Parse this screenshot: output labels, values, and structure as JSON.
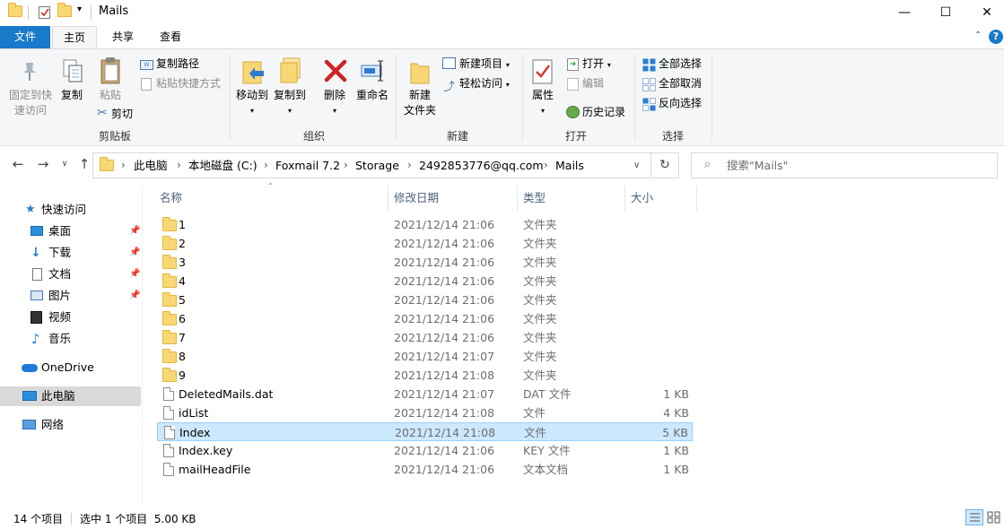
{
  "window": {
    "title": "Mails",
    "minimize": "—",
    "maximize": "☐",
    "close": "✕"
  },
  "ribbon_tabs": {
    "file": "文件",
    "home": "主页",
    "share": "共享",
    "view": "查看"
  },
  "ribbon": {
    "clipboard": {
      "pin_quick_access": "固定到快速访问",
      "pin_line1": "固定到快",
      "pin_line2": "速访问",
      "copy": "复制",
      "paste": "粘贴",
      "copy_path": "复制路径",
      "paste_shortcut": "粘贴快捷方式",
      "cut": "剪切",
      "label": "剪贴板"
    },
    "organize": {
      "move_to": "移动到",
      "copy_to": "复制到",
      "delete": "删除",
      "rename": "重命名",
      "label": "组织"
    },
    "new": {
      "new_folder_l1": "新建",
      "new_folder_l2": "文件夹",
      "new_item": "新建项目",
      "easy_access": "轻松访问",
      "label": "新建"
    },
    "open": {
      "properties": "属性",
      "open": "打开",
      "edit": "编辑",
      "history": "历史记录",
      "label": "打开"
    },
    "select": {
      "select_all": "全部选择",
      "select_none": "全部取消",
      "invert": "反向选择",
      "label": "选择"
    }
  },
  "address": {
    "crumbs": [
      "此电脑",
      "本地磁盘 (C:)",
      "Foxmail 7.2",
      "Storage",
      "2492853776@qq.com",
      "Mails"
    ],
    "search_placeholder": "搜索\"Mails\""
  },
  "nav": {
    "quick_access": "快速访问",
    "desktop": "桌面",
    "downloads": "下载",
    "documents": "文档",
    "pictures": "图片",
    "videos": "视频",
    "music": "音乐",
    "onedrive": "OneDrive",
    "this_pc": "此电脑",
    "network": "网络"
  },
  "columns": {
    "name": "名称",
    "date": "修改日期",
    "type": "类型",
    "size": "大小"
  },
  "files": [
    {
      "name": "1",
      "date": "2021/12/14 21:06",
      "type": "文件夹",
      "size": "",
      "kind": "folder"
    },
    {
      "name": "2",
      "date": "2021/12/14 21:06",
      "type": "文件夹",
      "size": "",
      "kind": "folder"
    },
    {
      "name": "3",
      "date": "2021/12/14 21:06",
      "type": "文件夹",
      "size": "",
      "kind": "folder"
    },
    {
      "name": "4",
      "date": "2021/12/14 21:06",
      "type": "文件夹",
      "size": "",
      "kind": "folder"
    },
    {
      "name": "5",
      "date": "2021/12/14 21:06",
      "type": "文件夹",
      "size": "",
      "kind": "folder"
    },
    {
      "name": "6",
      "date": "2021/12/14 21:06",
      "type": "文件夹",
      "size": "",
      "kind": "folder"
    },
    {
      "name": "7",
      "date": "2021/12/14 21:06",
      "type": "文件夹",
      "size": "",
      "kind": "folder"
    },
    {
      "name": "8",
      "date": "2021/12/14 21:07",
      "type": "文件夹",
      "size": "",
      "kind": "folder"
    },
    {
      "name": "9",
      "date": "2021/12/14 21:08",
      "type": "文件夹",
      "size": "",
      "kind": "folder"
    },
    {
      "name": "DeletedMails.dat",
      "date": "2021/12/14 21:07",
      "type": "DAT 文件",
      "size": "1 KB",
      "kind": "file"
    },
    {
      "name": "idList",
      "date": "2021/12/14 21:08",
      "type": "文件",
      "size": "4 KB",
      "kind": "file"
    },
    {
      "name": "Index",
      "date": "2021/12/14 21:08",
      "type": "文件",
      "size": "5 KB",
      "kind": "file",
      "selected": true
    },
    {
      "name": "Index.key",
      "date": "2021/12/14 21:06",
      "type": "KEY 文件",
      "size": "1 KB",
      "kind": "file"
    },
    {
      "name": "mailHeadFile",
      "date": "2021/12/14 21:06",
      "type": "文本文档",
      "size": "1 KB",
      "kind": "file"
    }
  ],
  "status": {
    "count": "14 个项目",
    "selection": "选中 1 个项目  5.00 KB"
  },
  "colors": {
    "accent": "#1979ca",
    "selection": "#cce8ff",
    "folder": "#f8d775"
  }
}
